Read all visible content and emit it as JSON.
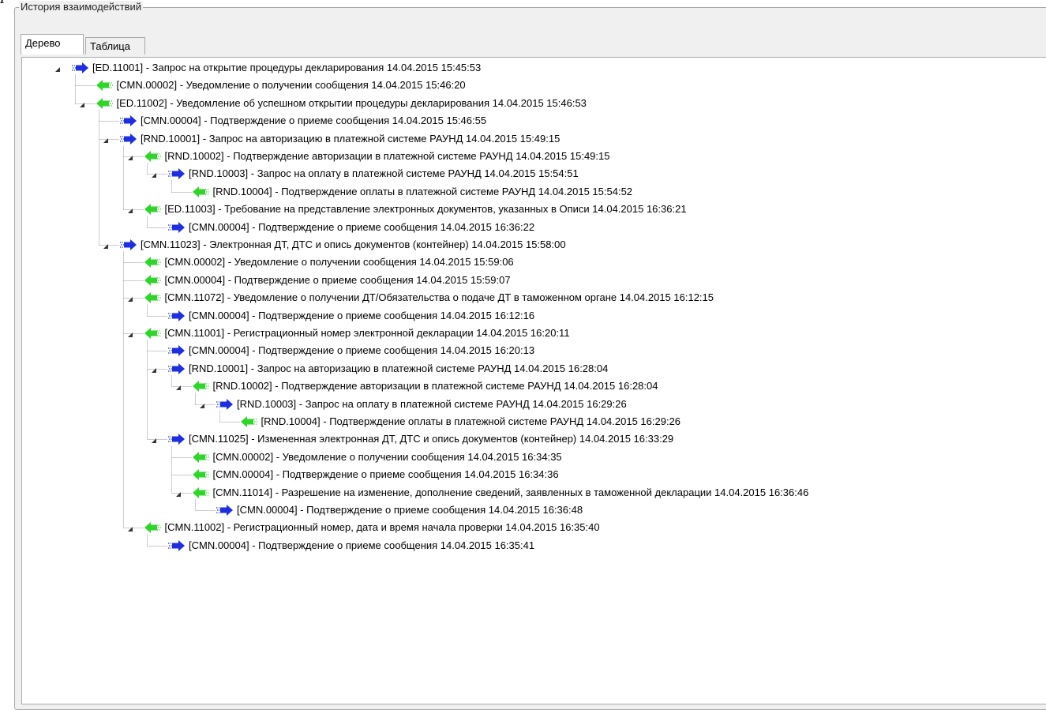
{
  "panel": {
    "title": "История взаимодействий"
  },
  "tabs": [
    {
      "label": "Дерево",
      "active": true
    },
    {
      "label": "Таблица",
      "active": false
    }
  ],
  "colors": {
    "outgoing": "#1f2fe0",
    "incoming": "#2fd62a",
    "connector": "#9a9a9a"
  },
  "tree": [
    {
      "level": 0,
      "dir": "out",
      "expanded": true,
      "text": "[ED.11001] - Запрос на открытие процедуры декларирования 14.04.2015 15:45:53"
    },
    {
      "level": 1,
      "dir": "in",
      "expanded": null,
      "text": "[CMN.00002] - Уведомление о получении сообщения 14.04.2015 15:46:20"
    },
    {
      "level": 1,
      "dir": "in",
      "expanded": true,
      "text": "[ED.11002] - Уведомление об успешном открытии процедуры декларирования 14.04.2015 15:46:53"
    },
    {
      "level": 2,
      "dir": "out",
      "expanded": null,
      "text": "[CMN.00004] - Подтверждение о приеме сообщения 14.04.2015 15:46:55"
    },
    {
      "level": 2,
      "dir": "out",
      "expanded": true,
      "text": "[RND.10001] - Запрос на авторизацию в платежной системе РАУНД 14.04.2015 15:49:15"
    },
    {
      "level": 3,
      "dir": "in",
      "expanded": true,
      "text": "[RND.10002] - Подтверждение авторизации в платежной системе РАУНД 14.04.2015 15:49:15"
    },
    {
      "level": 4,
      "dir": "out",
      "expanded": true,
      "text": "[RND.10003] - Запрос на оплату в платежной системе РАУНД 14.04.2015 15:54:51"
    },
    {
      "level": 5,
      "dir": "in",
      "expanded": null,
      "text": "[RND.10004] - Подтверждение оплаты в платежной системе РАУНД 14.04.2015 15:54:52"
    },
    {
      "level": 3,
      "dir": "in",
      "expanded": true,
      "text": "[ED.11003] - Требование на представление электронных документов, указанных в Описи 14.04.2015 16:36:21"
    },
    {
      "level": 4,
      "dir": "out",
      "expanded": null,
      "text": "[CMN.00004] - Подтверждение о приеме сообщения 14.04.2015 16:36:22"
    },
    {
      "level": 2,
      "dir": "out",
      "expanded": true,
      "text": "[CMN.11023] - Электронная ДТ, ДТС и опись документов (контейнер) 14.04.2015 15:58:00"
    },
    {
      "level": 3,
      "dir": "in",
      "expanded": null,
      "text": "[CMN.00002] - Уведомление о получении сообщения 14.04.2015 15:59:06"
    },
    {
      "level": 3,
      "dir": "in",
      "expanded": null,
      "text": "[CMN.00004] - Подтверждение о приеме сообщения 14.04.2015 15:59:07"
    },
    {
      "level": 3,
      "dir": "in",
      "expanded": true,
      "text": "[CMN.11072] - Уведомление о получении ДТ/Обязательства о подаче ДТ в таможенном органе 14.04.2015 16:12:15"
    },
    {
      "level": 4,
      "dir": "out",
      "expanded": null,
      "text": "[CMN.00004] - Подтверждение о приеме сообщения 14.04.2015 16:12:16"
    },
    {
      "level": 3,
      "dir": "in",
      "expanded": true,
      "text": "[CMN.11001] - Регистрационный номер электронной декларации 14.04.2015 16:20:11"
    },
    {
      "level": 4,
      "dir": "out",
      "expanded": null,
      "text": "[CMN.00004] - Подтверждение о приеме сообщения 14.04.2015 16:20:13"
    },
    {
      "level": 4,
      "dir": "out",
      "expanded": true,
      "text": "[RND.10001] - Запрос на авторизацию в платежной системе РАУНД 14.04.2015 16:28:04"
    },
    {
      "level": 5,
      "dir": "in",
      "expanded": true,
      "text": "[RND.10002] - Подтверждение авторизации в платежной системе РАУНД 14.04.2015 16:28:04"
    },
    {
      "level": 6,
      "dir": "out",
      "expanded": true,
      "text": "[RND.10003] - Запрос на оплату в платежной системе РАУНД 14.04.2015 16:29:26"
    },
    {
      "level": 7,
      "dir": "in",
      "expanded": null,
      "text": "[RND.10004] - Подтверждение оплаты в платежной системе РАУНД 14.04.2015 16:29:26"
    },
    {
      "level": 4,
      "dir": "out",
      "expanded": true,
      "text": "[CMN.11025] - Измененная электронная ДТ, ДТС и опись документов (контейнер) 14.04.2015 16:33:29"
    },
    {
      "level": 5,
      "dir": "in",
      "expanded": null,
      "text": "[CMN.00002] - Уведомление о получении сообщения 14.04.2015 16:34:35"
    },
    {
      "level": 5,
      "dir": "in",
      "expanded": null,
      "text": "[CMN.00004] - Подтверждение о приеме сообщения 14.04.2015 16:34:36"
    },
    {
      "level": 5,
      "dir": "in",
      "expanded": true,
      "text": "[CMN.11014] - Разрешение на изменение, дополнение сведений, заявленных в таможенной декларации 14.04.2015 16:36:46"
    },
    {
      "level": 6,
      "dir": "out",
      "expanded": null,
      "text": "[CMN.00004] - Подтверждение о приеме сообщения 14.04.2015 16:36:48"
    },
    {
      "level": 3,
      "dir": "in",
      "expanded": true,
      "text": "[CMN.11002] - Регистрационный номер, дата и время начала проверки 14.04.2015 16:35:40"
    },
    {
      "level": 4,
      "dir": "out",
      "expanded": null,
      "text": "[CMN.00004] - Подтверждение о приеме сообщения 14.04.2015 16:35:41"
    }
  ]
}
